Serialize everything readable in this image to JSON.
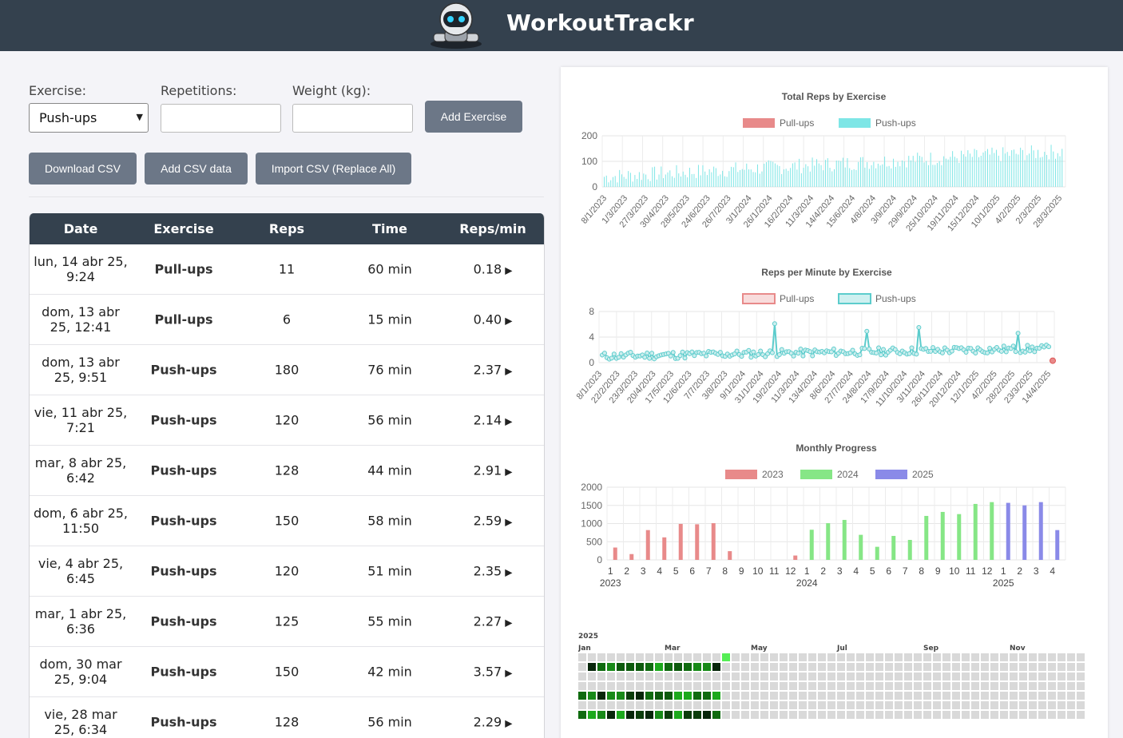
{
  "app": {
    "title": "WorkoutTrackr"
  },
  "form": {
    "exercise_label": "Exercise:",
    "exercise_value": "Push-ups",
    "reps_label": "Repetitions:",
    "weight_label": "Weight (kg):",
    "add_button": "Add Exercise"
  },
  "csv": {
    "download": "Download CSV",
    "add": "Add CSV data",
    "import": "Import CSV (Replace All)"
  },
  "table": {
    "headers": [
      "Date",
      "Exercise",
      "Reps",
      "Time",
      "Reps/min"
    ],
    "rows": [
      {
        "date": "lun, 14 abr 25, 9:24",
        "exercise": "Pull-ups",
        "reps": "11",
        "time": "60 min",
        "rpm": "0.18"
      },
      {
        "date": "dom, 13 abr 25, 12:41",
        "exercise": "Pull-ups",
        "reps": "6",
        "time": "15 min",
        "rpm": "0.40"
      },
      {
        "date": "dom, 13 abr 25, 9:51",
        "exercise": "Push-ups",
        "reps": "180",
        "time": "76 min",
        "rpm": "2.37"
      },
      {
        "date": "vie, 11 abr 25, 7:21",
        "exercise": "Push-ups",
        "reps": "120",
        "time": "56 min",
        "rpm": "2.14"
      },
      {
        "date": "mar, 8 abr 25, 6:42",
        "exercise": "Push-ups",
        "reps": "128",
        "time": "44 min",
        "rpm": "2.91"
      },
      {
        "date": "dom, 6 abr 25, 11:50",
        "exercise": "Push-ups",
        "reps": "150",
        "time": "58 min",
        "rpm": "2.59"
      },
      {
        "date": "vie, 4 abr 25, 6:45",
        "exercise": "Push-ups",
        "reps": "120",
        "time": "51 min",
        "rpm": "2.35"
      },
      {
        "date": "mar, 1 abr 25, 6:36",
        "exercise": "Push-ups",
        "reps": "125",
        "time": "55 min",
        "rpm": "2.27"
      },
      {
        "date": "dom, 30 mar 25, 9:04",
        "exercise": "Push-ups",
        "reps": "150",
        "time": "42 min",
        "rpm": "3.57"
      },
      {
        "date": "vie, 28 mar 25, 6:34",
        "exercise": "Push-ups",
        "reps": "128",
        "time": "56 min",
        "rpm": "2.29"
      }
    ]
  },
  "chart_data": [
    {
      "type": "bar",
      "title": "Total Reps by Exercise",
      "legend": [
        "Pull-ups",
        "Push-ups"
      ],
      "colors": {
        "Pull-ups": "#e88a8a",
        "Push-ups": "#7ee6e6"
      },
      "ylim": [
        0,
        200
      ],
      "yticks": [
        0,
        100,
        200
      ],
      "x_tick_labels": [
        "8/1/2023",
        "1/3/2023",
        "27/3/2023",
        "30/4/2023",
        "28/5/2023",
        "24/6/2023",
        "26/7/2023",
        "3/1/2024",
        "26/1/2024",
        "16/2/2024",
        "11/3/2024",
        "14/4/2024",
        "15/6/2024",
        "4/8/2024",
        "3/9/2024",
        "29/9/2024",
        "25/10/2024",
        "19/11/2024",
        "15/12/2024",
        "10/1/2025",
        "4/2/2025",
        "2/3/2025",
        "28/3/2025"
      ],
      "note": "Push-ups bars grow from ~40 to ~150 over time"
    },
    {
      "type": "line",
      "title": "Reps per Minute by Exercise",
      "legend": [
        "Pull-ups",
        "Push-ups"
      ],
      "colors": {
        "Pull-ups": "#e88a8a",
        "Push-ups": "#5ccccc"
      },
      "ylim": [
        0,
        8
      ],
      "yticks": [
        0,
        4,
        8
      ],
      "x_tick_labels": [
        "8/1/2023",
        "22/2/2023",
        "23/3/2023",
        "20/4/2023",
        "17/5/2023",
        "12/6/2023",
        "7/7/2023",
        "3/8/2023",
        "9/1/2024",
        "31/1/2024",
        "19/2/2024",
        "11/3/2024",
        "13/4/2024",
        "8/6/2024",
        "27/7/2024",
        "24/8/2024",
        "17/9/2024",
        "11/10/2024",
        "3/11/2024",
        "26/11/2024",
        "20/12/2024",
        "12/1/2025",
        "4/2/2025",
        "28/2/2025",
        "23/3/2025",
        "14/4/2025"
      ]
    },
    {
      "type": "bar",
      "title": "Monthly Progress",
      "legend": [
        "2023",
        "2024",
        "2025"
      ],
      "colors": {
        "2023": "#e88a8a",
        "2024": "#86e686",
        "2025": "#8a8ae8"
      },
      "ylim": [
        0,
        2000
      ],
      "yticks": [
        0,
        500,
        1000,
        1500,
        2000
      ],
      "categories": [
        "1",
        "2",
        "3",
        "4",
        "5",
        "6",
        "7",
        "8",
        "9",
        "10",
        "11",
        "12",
        "1",
        "2",
        "3",
        "4",
        "5",
        "6",
        "7",
        "8",
        "9",
        "10",
        "11",
        "12",
        "1",
        "2",
        "3",
        "4"
      ],
      "year_labels": [
        "2023",
        "2024",
        "2025"
      ],
      "values": [
        340,
        160,
        820,
        620,
        990,
        980,
        1010,
        240,
        0,
        0,
        0,
        120,
        830,
        1010,
        1100,
        690,
        360,
        660,
        550,
        1210,
        1320,
        1260,
        1540,
        1590,
        1570,
        1500,
        1590,
        820
      ]
    }
  ],
  "heatmap": {
    "year": "2025",
    "months": [
      "Jan",
      "Mar",
      "May",
      "Jul",
      "Sep",
      "Nov"
    ]
  }
}
